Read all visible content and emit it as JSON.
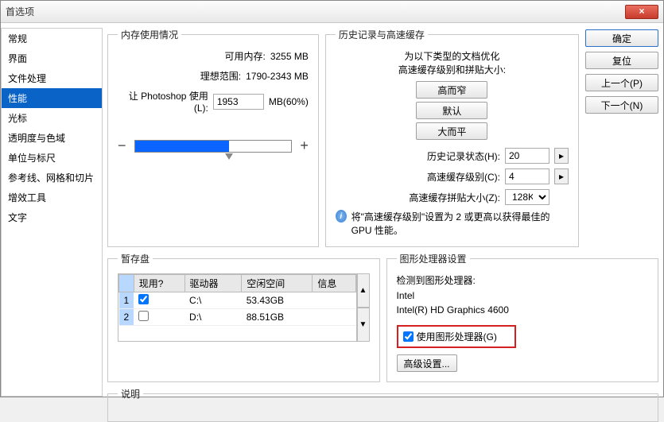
{
  "window": {
    "title": "首选项"
  },
  "sidebar": {
    "items": [
      {
        "label": "常规"
      },
      {
        "label": "界面"
      },
      {
        "label": "文件处理"
      },
      {
        "label": "性能",
        "selected": true
      },
      {
        "label": "光标"
      },
      {
        "label": "透明度与色域"
      },
      {
        "label": "单位与标尺"
      },
      {
        "label": "参考线、网格和切片"
      },
      {
        "label": "增效工具"
      },
      {
        "label": "文字"
      }
    ]
  },
  "memory": {
    "legend": "内存使用情况",
    "available_label": "可用内存:",
    "available_value": "3255 MB",
    "ideal_label": "理想范围:",
    "ideal_value": "1790-2343 MB",
    "let_use_label": "让 Photoshop 使用(L):",
    "let_use_value": "1953",
    "unit_suffix": "MB(60%)",
    "minus": "−",
    "plus": "+"
  },
  "history": {
    "legend": "历史记录与高速缓存",
    "note_top1": "为以下类型的文档优化",
    "note_top2": "高速缓存级别和拼贴大小:",
    "btn_tall": "高而窄",
    "btn_default": "默认",
    "btn_big": "大而平",
    "states_label": "历史记录状态(H):",
    "states_value": "20",
    "cache_label": "高速缓存级别(C):",
    "cache_value": "4",
    "tile_label": "高速缓存拼贴大小(Z):",
    "tile_value": "128K",
    "footer": "将\"高速缓存级别\"设置为 2 或更高以获得最佳的 GPU 性能。"
  },
  "buttons": {
    "ok": "确定",
    "reset": "复位",
    "prev": "上一个(P)",
    "next": "下一个(N)"
  },
  "scratch": {
    "legend": "暂存盘",
    "headers": {
      "active": "现用?",
      "drive": "驱动器",
      "free": "空闲空间",
      "info": "信息"
    },
    "rows": [
      {
        "n": "1",
        "active": true,
        "drive": "C:\\",
        "free": "53.43GB",
        "info": ""
      },
      {
        "n": "2",
        "active": false,
        "drive": "D:\\",
        "free": "88.51GB",
        "info": ""
      }
    ]
  },
  "gpu": {
    "legend": "图形处理器设置",
    "detected_label": "检测到图形处理器:",
    "vendor": "Intel",
    "model": "Intel(R) HD Graphics 4600",
    "use_label": "使用图形处理器(G)",
    "advanced": "高级设置..."
  },
  "desc": {
    "legend": "说明"
  }
}
